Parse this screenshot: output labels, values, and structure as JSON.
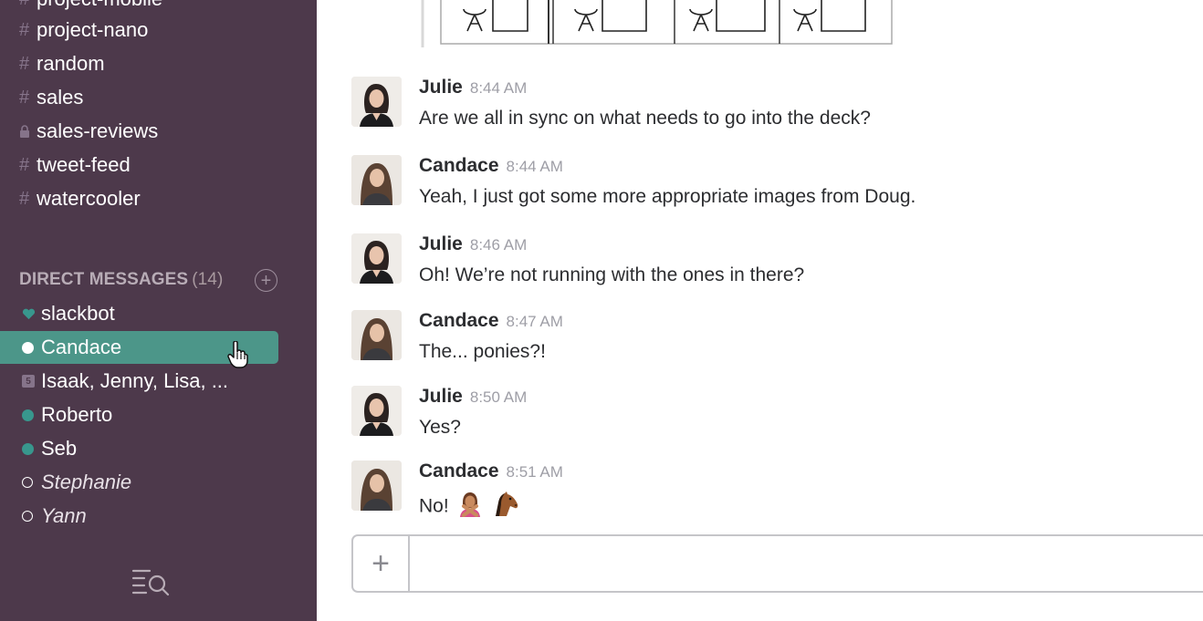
{
  "sidebar": {
    "channels": [
      {
        "name": "project-mobile",
        "type": "public"
      },
      {
        "name": "project-nano",
        "type": "public"
      },
      {
        "name": "random",
        "type": "public"
      },
      {
        "name": "sales",
        "type": "public"
      },
      {
        "name": "sales-reviews",
        "type": "private"
      },
      {
        "name": "tweet-feed",
        "type": "public"
      },
      {
        "name": "watercooler",
        "type": "public"
      }
    ],
    "direct_messages_header": "DIRECT MESSAGES",
    "direct_messages_count": "(14)",
    "direct_messages": [
      {
        "name": "slackbot",
        "presence": "heart"
      },
      {
        "name": "Candace",
        "presence": "active-selected"
      },
      {
        "name": "Isaak, Jenny, Lisa, ...",
        "presence": "group",
        "group_count": "5"
      },
      {
        "name": "Roberto",
        "presence": "online"
      },
      {
        "name": "Seb",
        "presence": "online"
      },
      {
        "name": "Stephanie",
        "presence": "away"
      },
      {
        "name": "Yann",
        "presence": "away"
      }
    ]
  },
  "messages": [
    {
      "author": "Julie",
      "time": "8:44 AM",
      "text": "Are we all in sync on what needs to go into the deck?"
    },
    {
      "author": "Candace",
      "time": "8:44 AM",
      "text": "Yeah, I just got some more appropriate images from Doug."
    },
    {
      "author": "Julie",
      "time": "8:46 AM",
      "text": "Oh! We’re not running with the ones in there?"
    },
    {
      "author": "Candace",
      "time": "8:47 AM",
      "text": "The... ponies?!"
    },
    {
      "author": "Julie",
      "time": "8:50 AM",
      "text": "Yes?"
    },
    {
      "author": "Candace",
      "time": "8:51 AM",
      "text": "No!"
    }
  ],
  "composer": {
    "plus_label": "+",
    "placeholder": ""
  },
  "colors": {
    "sidebar_bg": "#4d394b",
    "active_item": "#4c9689",
    "presence_online": "#38978d"
  }
}
